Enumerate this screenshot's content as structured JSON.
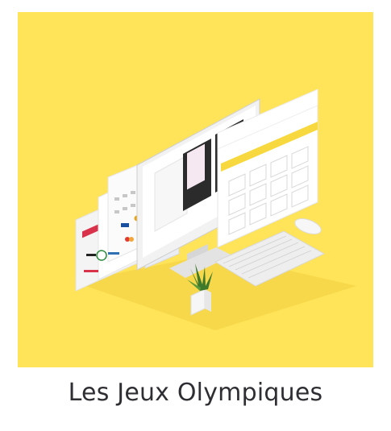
{
  "caption": "Les Jeux Olympiques",
  "colors": {
    "background": "#ffe358",
    "caption_text": "#2e2e33"
  },
  "scene_icons": [
    "monitor-icon",
    "keyboard-icon",
    "mouse-icon",
    "plant-icon"
  ]
}
